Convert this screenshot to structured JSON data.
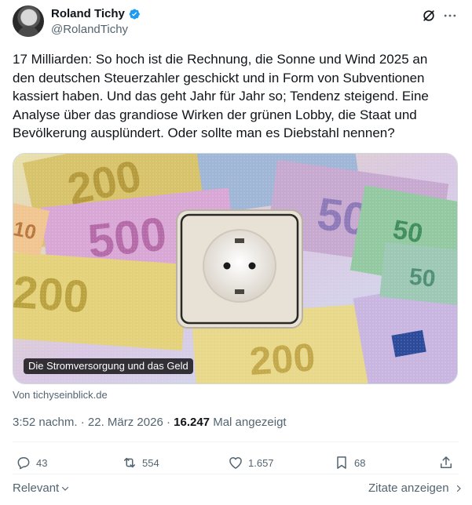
{
  "author": {
    "name": "Roland Tichy",
    "handle": "@RolandTichy",
    "verified": true
  },
  "tweet": {
    "text": "17 Milliarden: So hoch ist die Rechnung, die Sonne und Wind 2025 an den deutschen Steuerzahler geschickt und in Form von Subventionen kassiert haben. Und das geht Jahr für Jahr so; Tendenz steigend. Eine Analyse über das grandiose Wirken der grünen Lobby, die Staat und Bevölkerung ausplündert. Oder sollte man es Diebstahl nennen?"
  },
  "card": {
    "caption": "Die Stromversorgung und das Geld",
    "source": "Von tichyseinblick.de",
    "image_subject": "power socket on euro banknotes",
    "banknote_labels": [
      "200",
      "500",
      "200",
      "200",
      "50",
      "50",
      "200",
      "10"
    ]
  },
  "meta": {
    "time": "3:52 nachm.",
    "separator": "·",
    "date": "22. März 2026",
    "views": "16.247",
    "views_label": "Mal angezeigt"
  },
  "actions": {
    "replies": "43",
    "reposts": "554",
    "likes": "1.657",
    "bookmarks": "68"
  },
  "footer": {
    "sort_label": "Relevant",
    "quotes_label": "Zitate anzeigen"
  },
  "colors": {
    "verified_blue": "#1d9bf0",
    "text": "#0f1419",
    "secondary": "#536471"
  }
}
